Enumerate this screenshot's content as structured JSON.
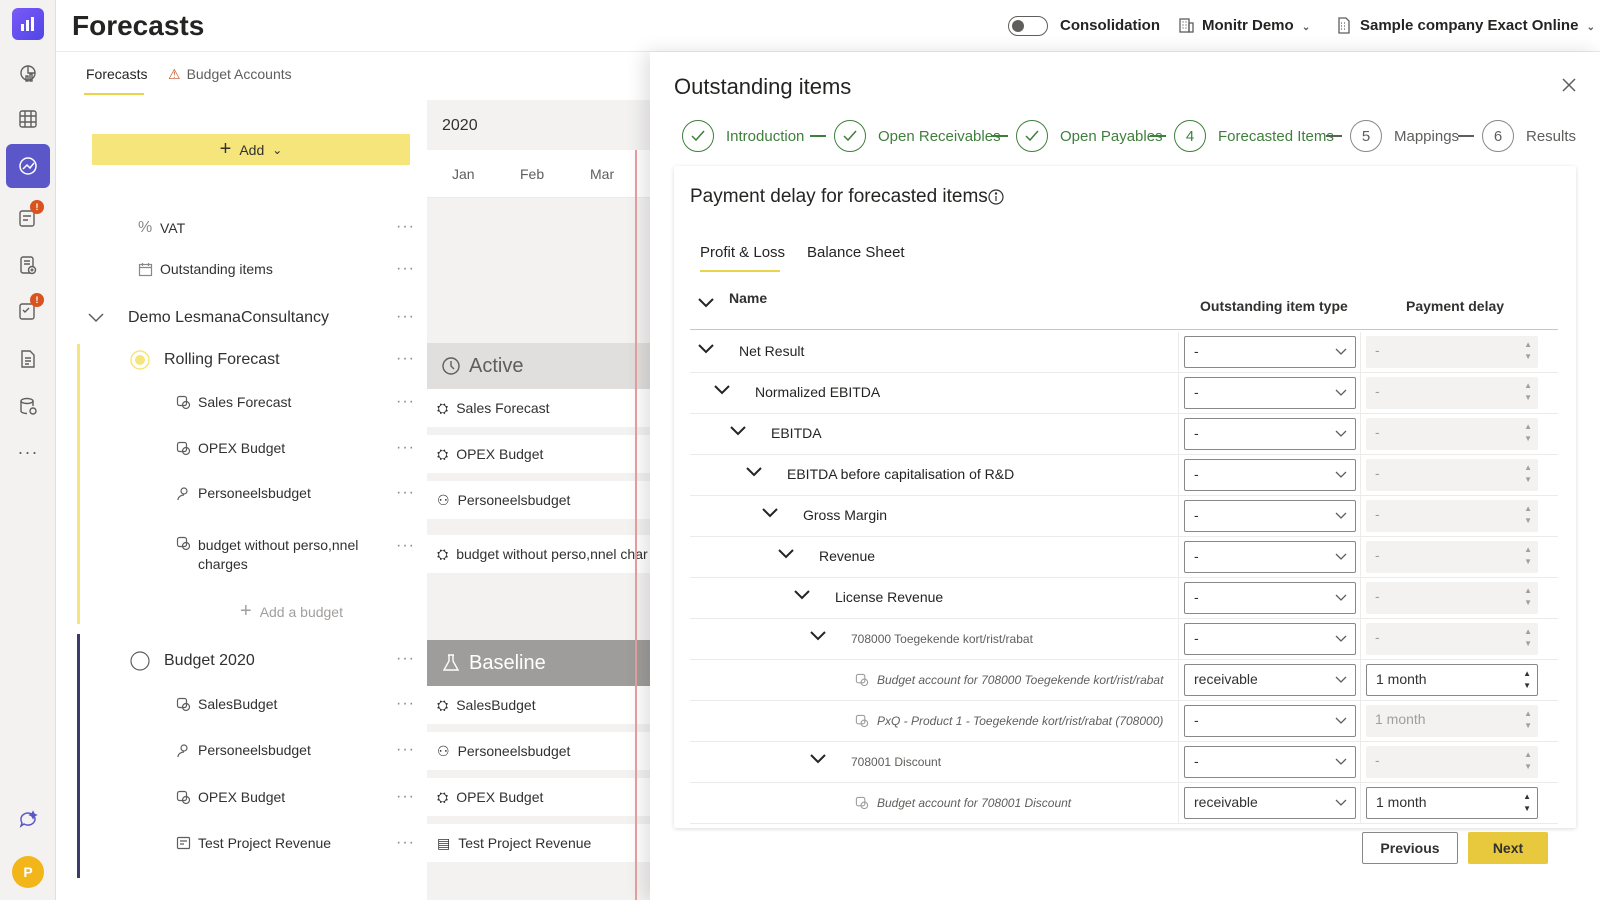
{
  "header": {
    "title": "Forecasts",
    "consolidation_label": "Consolidation",
    "org_label": "Monitr Demo",
    "company_label": "Sample company Exact Online"
  },
  "user": {
    "avatar_initial": "P"
  },
  "subnav": {
    "tabs": [
      "Forecasts",
      "Budget Accounts"
    ]
  },
  "tree": {
    "add_label": "Add",
    "vat_label": "VAT",
    "outstanding_label": "Outstanding items",
    "group_label": "Demo LesmanaConsultancy",
    "rolling": {
      "label": "Rolling Forecast",
      "items": [
        "Sales Forecast",
        "OPEX Budget",
        "Personeelsbudget",
        "budget without perso,nnel charges"
      ],
      "add_budget": "Add a budget"
    },
    "budget2020": {
      "label": "Budget 2020",
      "items": [
        "SalesBudget",
        "Personeelsbudget",
        "OPEX Budget",
        "Test Project Revenue"
      ]
    }
  },
  "timeline": {
    "year": "2020",
    "months": [
      "Jan",
      "Feb",
      "Mar"
    ],
    "active_label": "Active",
    "baseline_label": "Baseline",
    "active_items": [
      "Sales Forecast",
      "OPEX Budget",
      "Personeelsbudget",
      "budget without perso,nnel char"
    ],
    "baseline_items": [
      "SalesBudget",
      "Personeelsbudget",
      "OPEX Budget",
      "Test Project Revenue"
    ]
  },
  "dialog": {
    "title": "Outstanding items",
    "steps": [
      {
        "num": "",
        "label": "Introduction",
        "state": "done"
      },
      {
        "num": "",
        "label": "Open Receivables",
        "state": "done"
      },
      {
        "num": "",
        "label": "Open Payables",
        "state": "done"
      },
      {
        "num": "4",
        "label": "Forecasted Items",
        "state": "current"
      },
      {
        "num": "5",
        "label": "Mappings",
        "state": "todo"
      },
      {
        "num": "6",
        "label": "Results",
        "state": "todo"
      }
    ],
    "card_title": "Payment delay for forecasted items",
    "tabs": [
      "Profit & Loss",
      "Balance Sheet"
    ],
    "columns": {
      "name": "Name",
      "type": "Outstanding item type",
      "delay": "Payment delay"
    },
    "rows": [
      {
        "name": "Net Result",
        "type": "-",
        "delay": "-",
        "style": "normal"
      },
      {
        "name": "Normalized EBITDA",
        "type": "-",
        "delay": "-",
        "style": "normal"
      },
      {
        "name": "EBITDA",
        "type": "-",
        "delay": "-",
        "style": "normal"
      },
      {
        "name": "EBITDA before capitalisation of R&D",
        "type": "-",
        "delay": "-",
        "style": "normal"
      },
      {
        "name": "Gross Margin",
        "type": "-",
        "delay": "-",
        "style": "normal"
      },
      {
        "name": "Revenue",
        "type": "-",
        "delay": "-",
        "style": "normal"
      },
      {
        "name": "License Revenue",
        "type": "-",
        "delay": "-",
        "style": "normal"
      },
      {
        "name": "708000 Toegekende kort/rist/rabat",
        "type": "-",
        "delay": "-",
        "style": "small"
      },
      {
        "name": "Budget account for 708000 Toegekende kort/rist/rabat",
        "type": "receivable",
        "delay": "1 month",
        "style": "italic"
      },
      {
        "name": "PxQ - Product 1 - Toegekende kort/rist/rabat (708000)",
        "type": "-",
        "delay": "1 month",
        "style": "italic"
      },
      {
        "name": "708001 Discount",
        "type": "-",
        "delay": "-",
        "style": "small"
      },
      {
        "name": "Budget account for 708001 Discount",
        "type": "receivable",
        "delay": "1 month",
        "style": "italic"
      }
    ],
    "prev_label": "Previous",
    "next_label": "Next"
  }
}
